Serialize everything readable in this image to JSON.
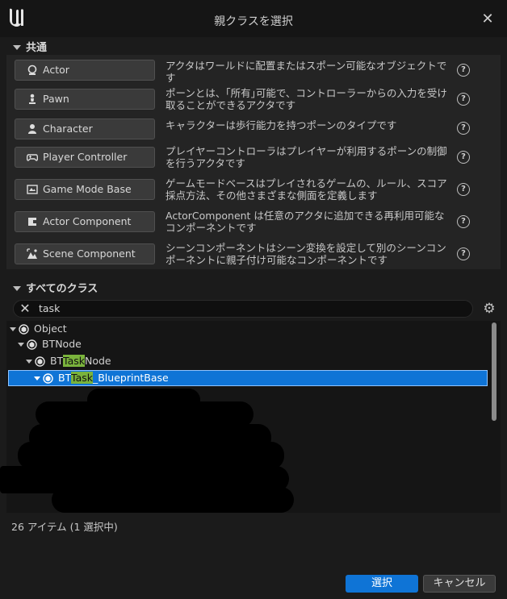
{
  "dialog": {
    "title": "親クラスを選択",
    "close_glyph": "✕"
  },
  "common": {
    "header": "共通",
    "items": [
      {
        "label": "Actor",
        "icon": "actor-icon",
        "desc": "アクタはワールドに配置またはスポーン可能なオブジェクトです"
      },
      {
        "label": "Pawn",
        "icon": "pawn-icon",
        "desc": "ポーンとは、｢所有｣可能で、コントローラーからの入力を受け取ることができるアクタです"
      },
      {
        "label": "Character",
        "icon": "character-icon",
        "desc": "キャラクターは歩行能力を持つポーンのタイプです"
      },
      {
        "label": "Player Controller",
        "icon": "gamepad-icon",
        "desc": "プレイヤーコントローラはプレイヤーが利用するポーンの制御を行うアクタです"
      },
      {
        "label": "Game Mode Base",
        "icon": "game-mode-icon",
        "desc": "ゲームモードベースはプレイされるゲームの、ルール、スコア採点方法、その他さまざまな側面を定義します"
      },
      {
        "label": "Actor Component",
        "icon": "actor-component-icon",
        "desc": "ActorComponent は任意のアクタに追加できる再利用可能なコンポーネントです"
      },
      {
        "label": "Scene Component",
        "icon": "scene-component-icon",
        "desc": "シーンコンポーネントはシーン変換を設定して別のシーンコンポーネントに親子付け可能なコンポーネントです"
      }
    ],
    "help_glyph": "?"
  },
  "all_classes": {
    "header": "すべてのクラス",
    "search": {
      "value": "task",
      "clear_glyph": "✕"
    },
    "settings_glyph": "⚙",
    "tree": [
      {
        "pre": "Object",
        "hl": "",
        "post": ""
      },
      {
        "pre": "BTNode",
        "hl": "",
        "post": ""
      },
      {
        "pre": "BT",
        "hl": "Task",
        "post": "Node"
      },
      {
        "pre": "BT",
        "hl": "Task",
        "post": "_BlueprintBase",
        "selected": true
      }
    ],
    "status": "26 アイテム (1 選択中)"
  },
  "footer": {
    "select_label": "選択",
    "cancel_label": "キャンセル"
  },
  "colors": {
    "accent": "#0f74d6",
    "highlight": "#7ab33c",
    "background": "#1b1b1b"
  }
}
